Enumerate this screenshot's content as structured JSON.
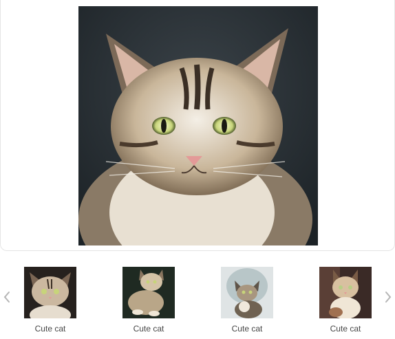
{
  "viewer": {
    "main_image_alt": "Cute cat"
  },
  "gallery": {
    "prev_icon": "chevron-left-icon",
    "next_icon": "chevron-right-icon",
    "thumbnails": [
      {
        "caption": "Cute cat"
      },
      {
        "caption": "Cute cat"
      },
      {
        "caption": "Cute cat"
      },
      {
        "caption": "Cute cat"
      }
    ]
  },
  "colors": {
    "border": "#e4e4e4",
    "caption_text": "#444444",
    "arrow": "#b5b5b5"
  }
}
